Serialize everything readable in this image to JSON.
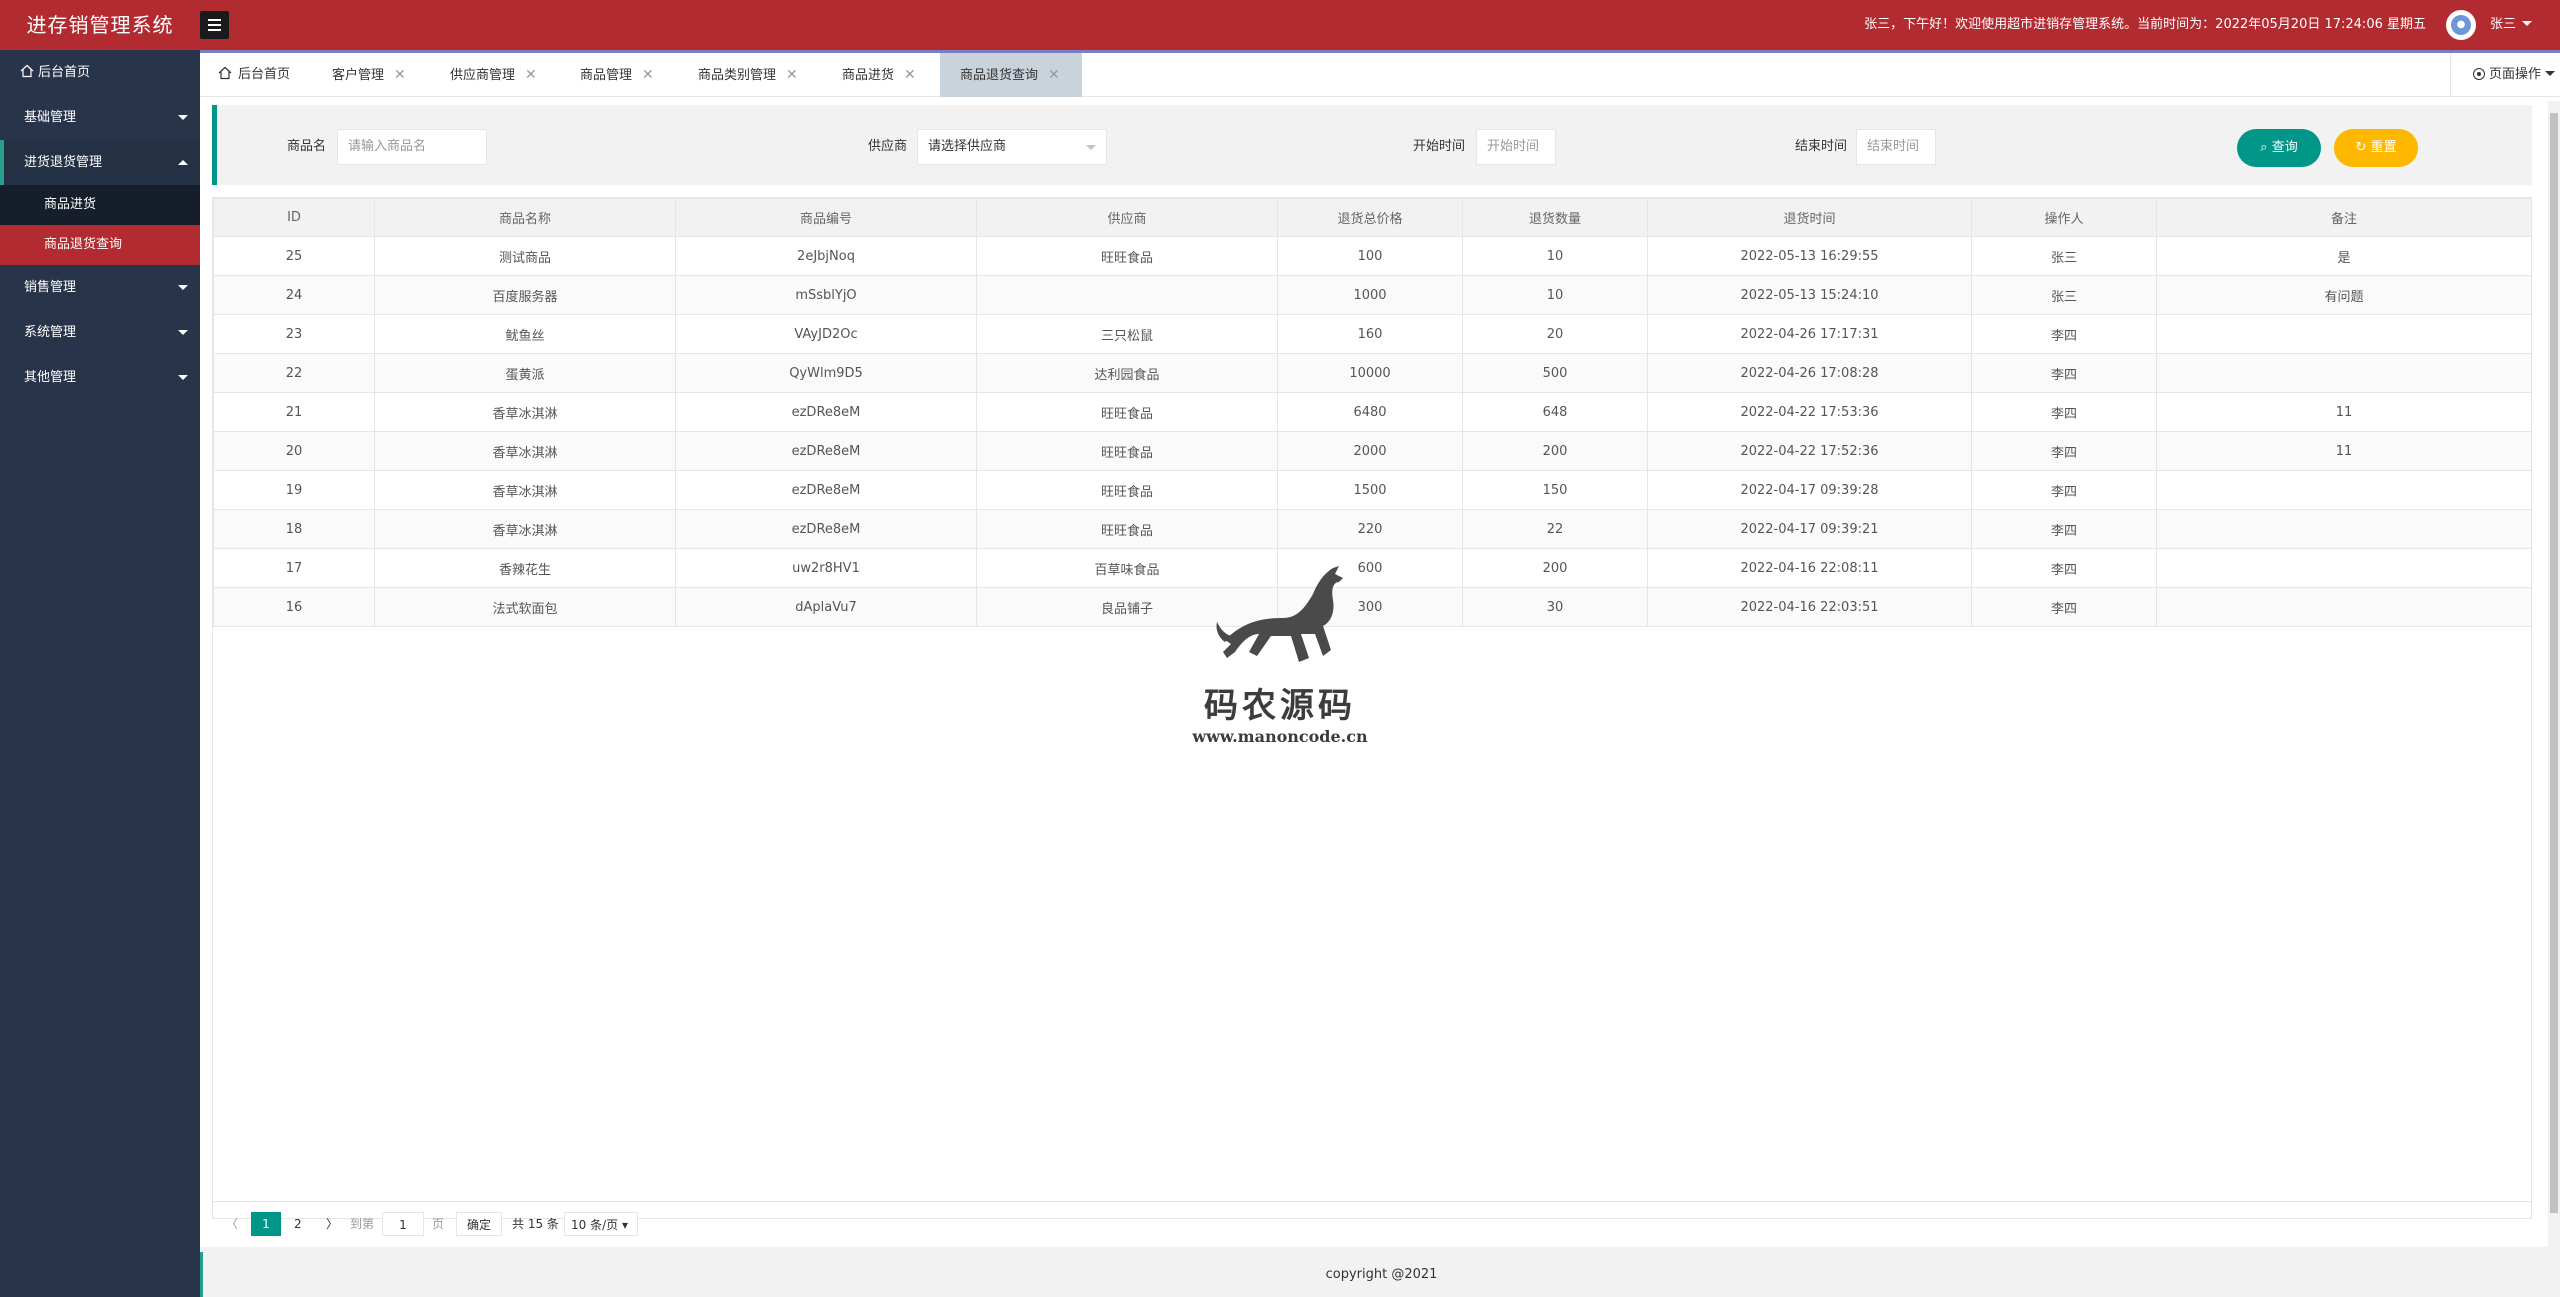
{
  "app": {
    "title": "进存销管理系统"
  },
  "header": {
    "greeting": "张三，下午好！欢迎使用超市进销存管理系统。当前时间为：2022年05月20日 17:24:06 星期五",
    "user_name": "张三"
  },
  "sidebar": {
    "home": "后台首页",
    "items": [
      {
        "label": "基础管理"
      },
      {
        "label": "进货退货管理"
      },
      {
        "label": "销售管理"
      },
      {
        "label": "系统管理"
      },
      {
        "label": "其他管理"
      }
    ],
    "sub_items": [
      {
        "label": "商品进货"
      },
      {
        "label": "商品退货查询"
      }
    ]
  },
  "tabs": [
    {
      "label": "后台首页"
    },
    {
      "label": "客户管理"
    },
    {
      "label": "供应商管理"
    },
    {
      "label": "商品管理"
    },
    {
      "label": "商品类别管理"
    },
    {
      "label": "商品进货"
    },
    {
      "label": "商品退货查询"
    }
  ],
  "page_ops": "页面操作",
  "search": {
    "goods_label": "商品名",
    "goods_placeholder": "请输入商品名",
    "provider_label": "供应商",
    "provider_value": "请选择供应商",
    "start_label": "开始时间",
    "start_placeholder": "开始时间",
    "end_label": "结束时间",
    "end_placeholder": "结束时间",
    "query_button": "查询",
    "reset_button": "重置"
  },
  "table": {
    "columns": [
      "ID",
      "商品名称",
      "商品编号",
      "供应商",
      "退货总价格",
      "退货数量",
      "退货时间",
      "操作人",
      "备注"
    ],
    "rows": [
      [
        "25",
        "测试商品",
        "2eJbjNoq",
        "旺旺食品",
        "100",
        "10",
        "2022-05-13 16:29:55",
        "张三",
        "是"
      ],
      [
        "24",
        "百度服务器",
        "mSsblYjO",
        "",
        "1000",
        "10",
        "2022-05-13 15:24:10",
        "张三",
        "有问题"
      ],
      [
        "23",
        "鱿鱼丝",
        "VAyJD2Oc",
        "三只松鼠",
        "160",
        "20",
        "2022-04-26 17:17:31",
        "李四",
        ""
      ],
      [
        "22",
        "蛋黄派",
        "QyWlm9D5",
        "达利园食品",
        "10000",
        "500",
        "2022-04-26 17:08:28",
        "李四",
        ""
      ],
      [
        "21",
        "香草冰淇淋",
        "ezDRe8eM",
        "旺旺食品",
        "6480",
        "648",
        "2022-04-22 17:53:36",
        "李四",
        "11"
      ],
      [
        "20",
        "香草冰淇淋",
        "ezDRe8eM",
        "旺旺食品",
        "2000",
        "200",
        "2022-04-22 17:52:36",
        "李四",
        "11"
      ],
      [
        "19",
        "香草冰淇淋",
        "ezDRe8eM",
        "旺旺食品",
        "1500",
        "150",
        "2022-04-17 09:39:28",
        "李四",
        ""
      ],
      [
        "18",
        "香草冰淇淋",
        "ezDRe8eM",
        "旺旺食品",
        "220",
        "22",
        "2022-04-17 09:39:21",
        "李四",
        ""
      ],
      [
        "17",
        "香辣花生",
        "uw2r8HV1",
        "百草味食品",
        "600",
        "200",
        "2022-04-16 22:08:11",
        "李四",
        ""
      ],
      [
        "16",
        "法式软面包",
        "dAplaVu7",
        "良品铺子",
        "300",
        "30",
        "2022-04-16 22:03:51",
        "李四",
        ""
      ]
    ]
  },
  "pager": {
    "page1": "1",
    "page2": "2",
    "goto_label": "到第",
    "goto_value": "1",
    "page_unit": "页",
    "confirm": "确定",
    "total": "共 15 条",
    "page_size": "10 条/页"
  },
  "watermark": {
    "title": "码农源码",
    "url": "www.manoncode.cn"
  },
  "footer": "copyright @2021",
  "colors": {
    "header": "#b22b30",
    "sidebar": "#28344a",
    "accent": "#009688",
    "warning": "#ffb800"
  }
}
